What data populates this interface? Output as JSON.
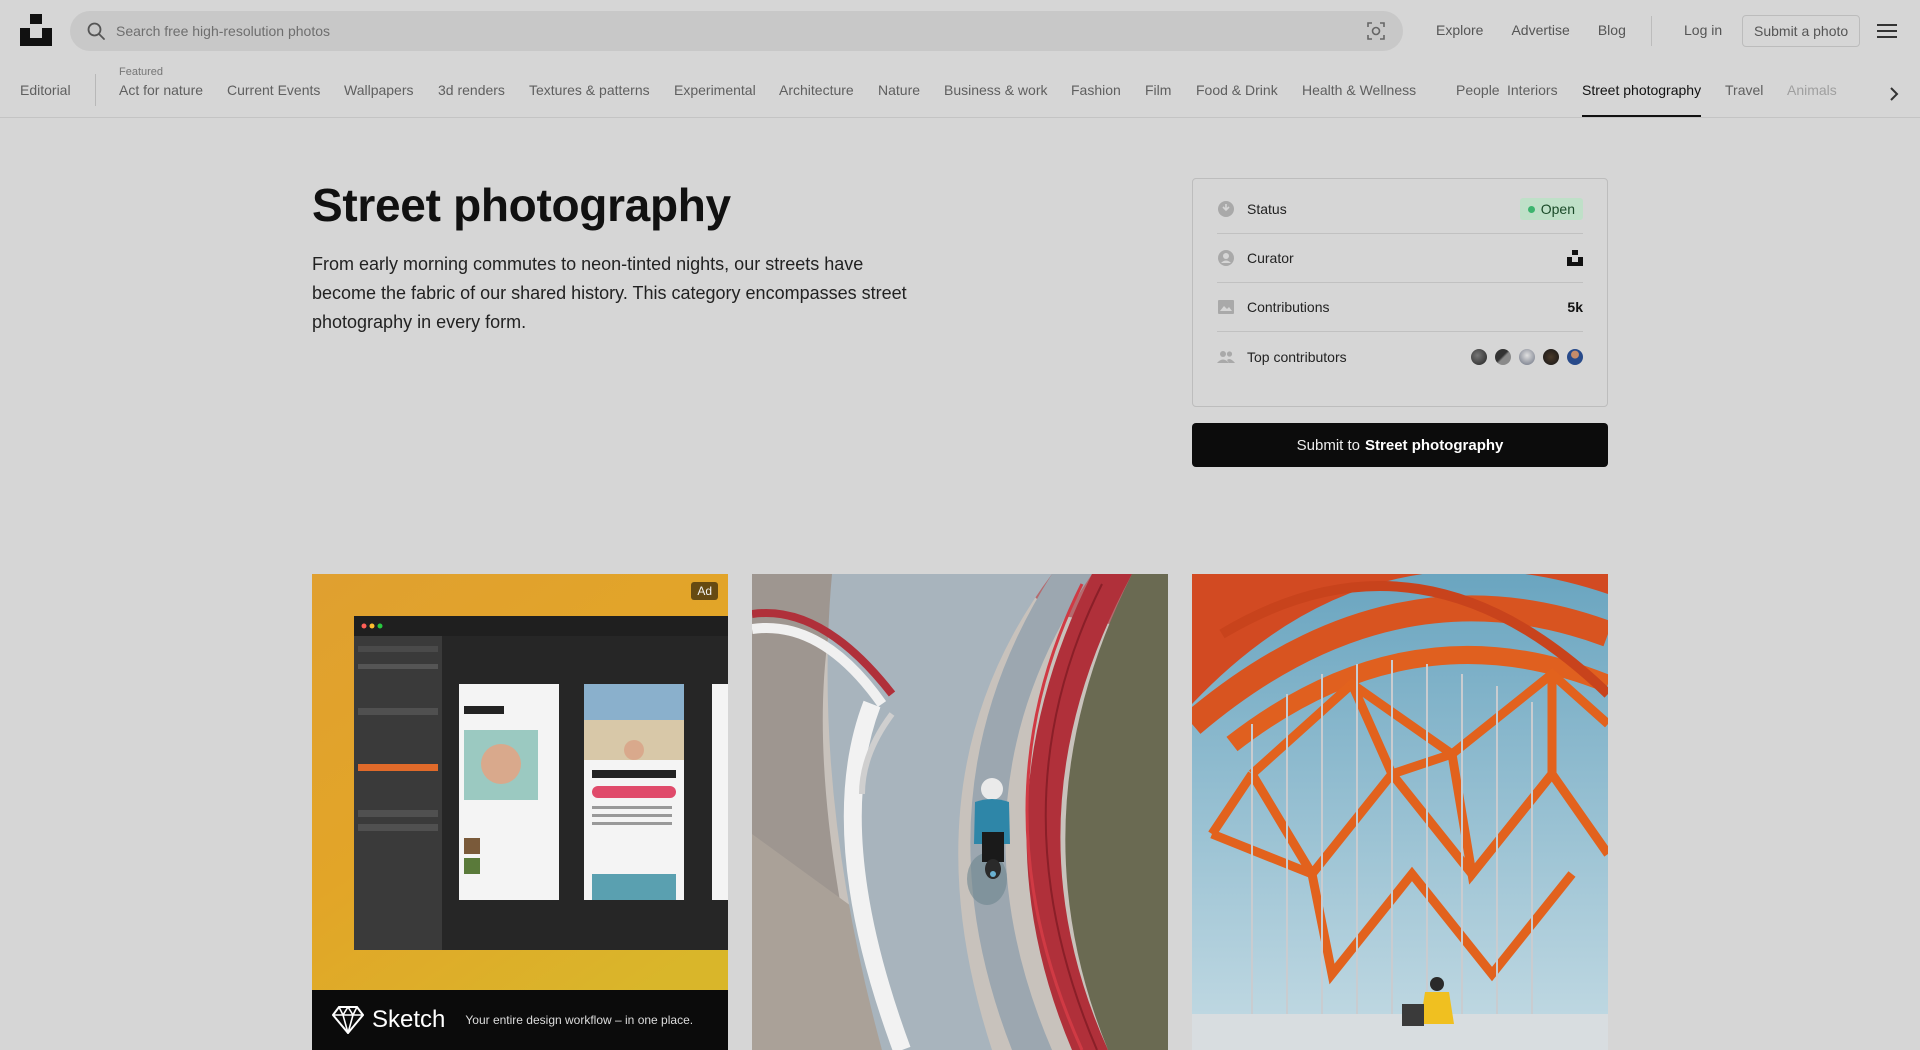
{
  "header": {
    "search_placeholder": "Search free high-resolution photos",
    "nav": [
      "Explore",
      "Advertise",
      "Blog"
    ],
    "login": "Log in",
    "submit_photo": "Submit a photo"
  },
  "tabs": {
    "editorial": "Editorial",
    "featured_label": "Featured",
    "items": [
      "Act for nature",
      "Current Events",
      "Wallpapers",
      "3d renders",
      "Textures & patterns",
      "Experimental",
      "Architecture",
      "Nature",
      "Business & work",
      "Fashion",
      "Film",
      "Food & Drink",
      "Health & Wellness",
      "People",
      "Interiors",
      "Street photography",
      "Travel",
      "Animals"
    ],
    "active": "Street photography"
  },
  "hero": {
    "title": "Street photography",
    "description": "From early morning commutes to neon-tinted nights, our streets have become the fabric of our shared history. This category encompasses street photography in every form."
  },
  "info": {
    "status_label": "Status",
    "status_value": "Open",
    "curator_label": "Curator",
    "contributions_label": "Contributions",
    "contributions_value": "5k",
    "top_contributors_label": "Top contributors"
  },
  "submit": {
    "prefix": "Submit to",
    "target": "Street photography"
  },
  "ad": {
    "badge": "Ad",
    "brand": "Sketch",
    "tagline": "Your entire design workflow – in one place."
  },
  "colors": {
    "background": "#d6d6d6",
    "accent_green": "#3cb46e",
    "button": "#0c0c0c"
  }
}
